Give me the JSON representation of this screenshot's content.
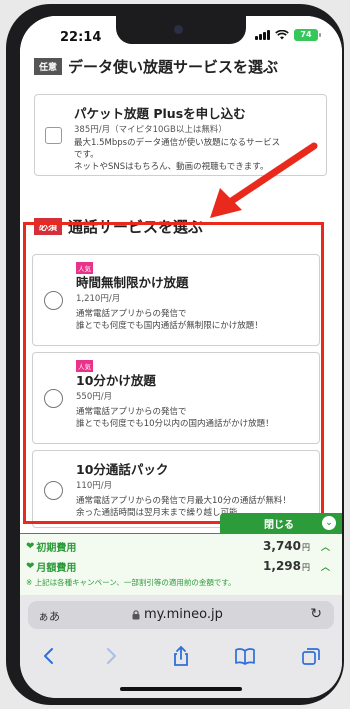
{
  "status_bar": {
    "time": "22:14",
    "battery": "74"
  },
  "data_section": {
    "tag": "任意",
    "title": "データ使い放題サービスを選ぶ",
    "option": {
      "title": "パケット放題 Plusを申し込む",
      "price": "385円/月（マイピタ10GB以上は無料）",
      "desc_line1": "最大1.5Mbpsのデータ通信が使い放題になるサービス",
      "desc_line2": "です。",
      "desc_line3": "ネットやSNSはもちろん、動画の視聴もできます。"
    }
  },
  "call_section": {
    "tag": "必須",
    "title": "通話サービスを選ぶ",
    "options": [
      {
        "badge": "人気",
        "title": "時間無制限かけ放題",
        "price": "1,210円/月",
        "desc_line1": "通常電話アプリからの発信で",
        "desc_line2": "誰とでも何度でも国内通話が無制限にかけ放題！"
      },
      {
        "badge": "人気",
        "title": "10分かけ放題",
        "price": "550円/月",
        "desc_line1": "通常電話アプリからの発信で",
        "desc_line2": "誰とでも何度でも10分以内の国内通話がかけ放題！"
      },
      {
        "title": "10分通話パック",
        "price": "110円/月",
        "desc_line1": "通常電話アプリからの発信で月最大10分の通話が無料！",
        "desc_line2": "余った通話時間は翌月末まで繰り越し可能。"
      }
    ]
  },
  "fees": {
    "close_label": "閉じる",
    "initial_label": "初期費用",
    "initial_value": "3,740",
    "monthly_label": "月額費用",
    "monthly_value": "1,298",
    "unit": "円",
    "note": "※ 上記は各種キャンペーン、一部割引等の適用前の金額です。"
  },
  "browser": {
    "aa_label": "ぁあ",
    "url": "my.mineo.jp"
  },
  "colors": {
    "accent_green": "#2c9b3a",
    "highlight_red": "#e8291c",
    "required_red": "#d3303a",
    "badge_pink": "#e8338a"
  }
}
